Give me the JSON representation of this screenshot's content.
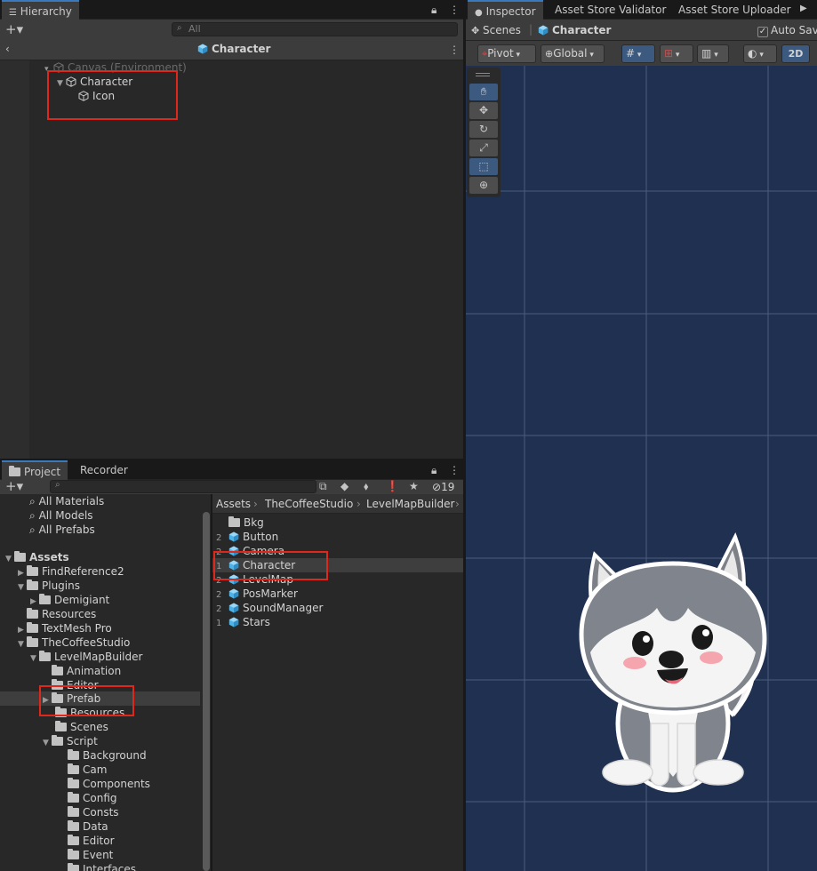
{
  "hierarchy": {
    "tab_label": "Hierarchy",
    "search_placeholder": "All",
    "prefab_title": "Character",
    "items": [
      {
        "label": "Canvas (Environment)",
        "dim": true
      },
      {
        "label": "Character"
      },
      {
        "label": "Icon"
      }
    ]
  },
  "right_tabs": [
    "Inspector",
    "Asset Store Validator",
    "Asset Store Uploader"
  ],
  "scene": {
    "breadcrumb_root": "Scenes",
    "breadcrumb_current": "Character",
    "auto_save": "Auto Save",
    "pivot": "Pivot",
    "global": "Global",
    "mode_2d": "2D",
    "bg_color": "#203050",
    "grid_color": "#5d6f8f"
  },
  "project": {
    "tab_label": "Project",
    "recorder_label": "Recorder",
    "hidden_count": "19",
    "favorites": [
      "All Materials",
      "All Models",
      "All Prefabs"
    ],
    "tree": [
      {
        "label": "Assets",
        "bold": true
      },
      {
        "label": "FindReference2"
      },
      {
        "label": "Plugins"
      },
      {
        "label": "Demigiant"
      },
      {
        "label": "Resources"
      },
      {
        "label": "TextMesh Pro"
      },
      {
        "label": "TheCoffeeStudio"
      },
      {
        "label": "LevelMapBuilder"
      },
      {
        "label": "Animation"
      },
      {
        "label": "Editor"
      },
      {
        "label": "Prefab"
      },
      {
        "label": "Resources"
      },
      {
        "label": "Scenes"
      },
      {
        "label": "Script"
      },
      {
        "label": "Background"
      },
      {
        "label": "Cam"
      },
      {
        "label": "Components"
      },
      {
        "label": "Config"
      },
      {
        "label": "Consts"
      },
      {
        "label": "Data"
      },
      {
        "label": "Editor"
      },
      {
        "label": "Event"
      },
      {
        "label": "Interfaces"
      }
    ],
    "path": [
      "Assets",
      "TheCoffeeStudio",
      "LevelMapBuilder"
    ],
    "files": [
      {
        "count": "",
        "label": "Bkg",
        "kind": "folder"
      },
      {
        "count": "2",
        "label": "Button",
        "kind": "prefab"
      },
      {
        "count": "2",
        "label": "Camera",
        "kind": "prefab"
      },
      {
        "count": "1",
        "label": "Character",
        "kind": "prefab"
      },
      {
        "count": "2",
        "label": "LevelMap",
        "kind": "prefab"
      },
      {
        "count": "2",
        "label": "PosMarker",
        "kind": "prefab"
      },
      {
        "count": "2",
        "label": "SoundManager",
        "kind": "prefab"
      },
      {
        "count": "1",
        "label": "Stars",
        "kind": "prefab"
      }
    ]
  },
  "colors": {
    "prefab_blue": "#4fb3e8",
    "highlight_red": "#e0271c",
    "active_tab_blue": "#3a79bb"
  }
}
